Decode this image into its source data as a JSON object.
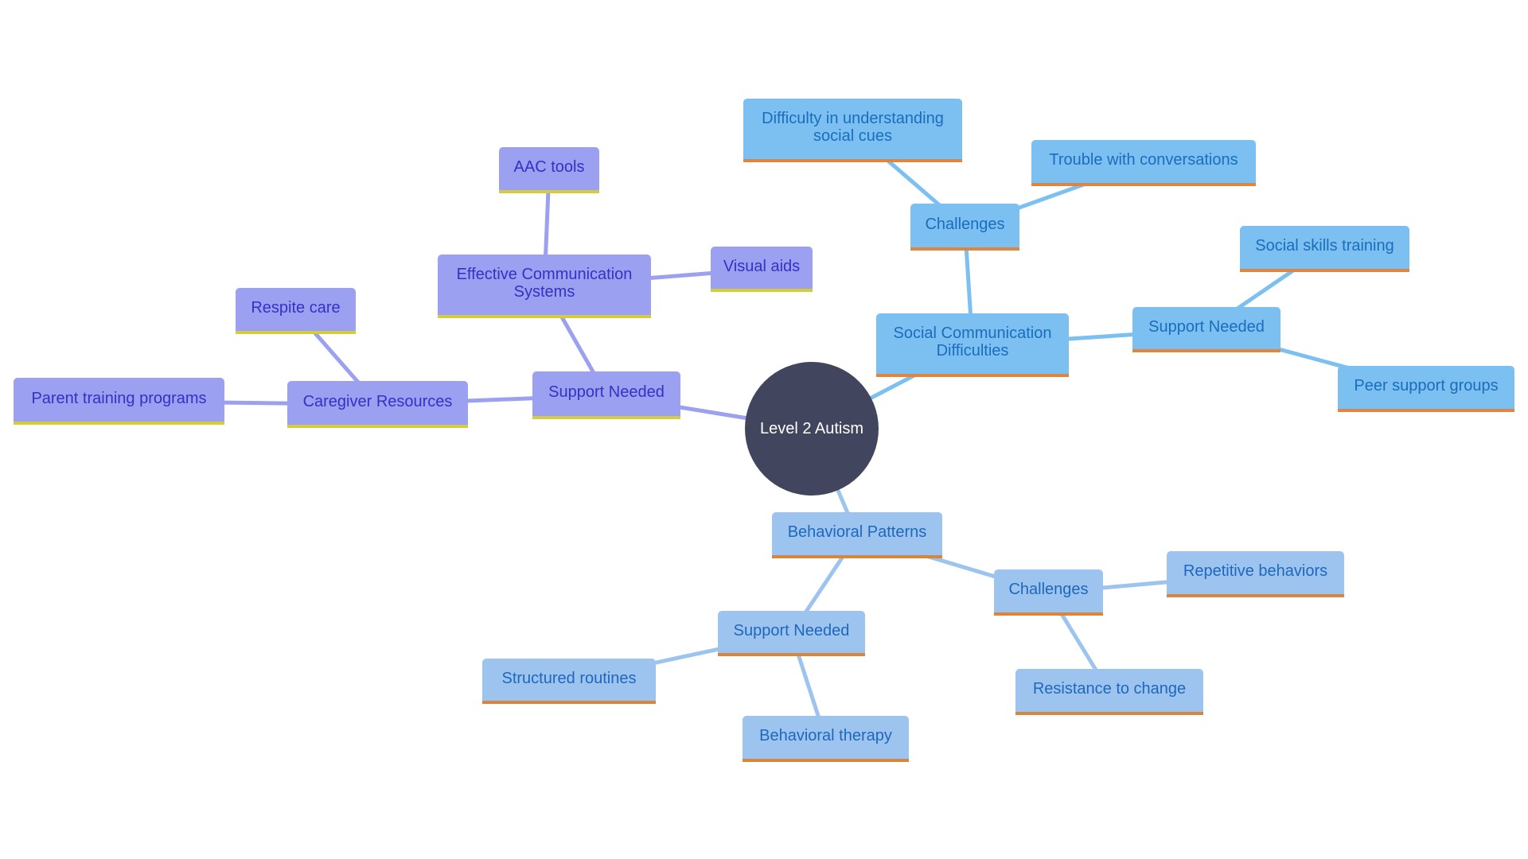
{
  "diagram": {
    "type": "mindmap",
    "colors": {
      "root_fill": "#41455d",
      "root_text": "#ffffff",
      "purple_fill": "#9ba0f1",
      "purple_text": "#3432c4",
      "purple_accent": "#d4cc38",
      "blue_fill": "#7cc0f1",
      "blue_text": "#1a6dbd",
      "blue_accent": "#e0843e",
      "lightblue_fill": "#9dc4ef",
      "lightblue_text": "#1d68bd",
      "lightblue_accent": "#d9853a"
    },
    "root": {
      "id": "root",
      "label": "Level 2 Autism"
    },
    "nodes": [
      {
        "id": "p_support",
        "label": "Support Needed",
        "parent": "root",
        "branch": "purple"
      },
      {
        "id": "p_ecs",
        "label": "Effective Communication Systems",
        "parent": "p_support",
        "branch": "purple"
      },
      {
        "id": "p_aac",
        "label": "AAC tools",
        "parent": "p_ecs",
        "branch": "purple"
      },
      {
        "id": "p_visual",
        "label": "Visual aids",
        "parent": "p_ecs",
        "branch": "purple"
      },
      {
        "id": "p_caregiver",
        "label": "Caregiver Resources",
        "parent": "p_support",
        "branch": "purple"
      },
      {
        "id": "p_respite",
        "label": "Respite care",
        "parent": "p_caregiver",
        "branch": "purple"
      },
      {
        "id": "p_parent",
        "label": "Parent training programs",
        "parent": "p_caregiver",
        "branch": "purple"
      },
      {
        "id": "b_scd",
        "label": "Social Communication Difficulties",
        "parent": "root",
        "branch": "blue"
      },
      {
        "id": "b_challenges",
        "label": "Challenges",
        "parent": "b_scd",
        "branch": "blue"
      },
      {
        "id": "b_cues",
        "label": "Difficulty in understanding social cues",
        "parent": "b_challenges",
        "branch": "blue"
      },
      {
        "id": "b_conv",
        "label": "Trouble with conversations",
        "parent": "b_challenges",
        "branch": "blue"
      },
      {
        "id": "b_support",
        "label": "Support Needed",
        "parent": "b_scd",
        "branch": "blue"
      },
      {
        "id": "b_skills",
        "label": "Social skills training",
        "parent": "b_support",
        "branch": "blue"
      },
      {
        "id": "b_peer",
        "label": "Peer support groups",
        "parent": "b_support",
        "branch": "blue"
      },
      {
        "id": "l_bp",
        "label": "Behavioral Patterns",
        "parent": "root",
        "branch": "lightblue"
      },
      {
        "id": "l_challenges",
        "label": "Challenges",
        "parent": "l_bp",
        "branch": "lightblue"
      },
      {
        "id": "l_repetitive",
        "label": "Repetitive behaviors",
        "parent": "l_challenges",
        "branch": "lightblue"
      },
      {
        "id": "l_resistance",
        "label": "Resistance to change",
        "parent": "l_challenges",
        "branch": "lightblue"
      },
      {
        "id": "l_support",
        "label": "Support Needed",
        "parent": "l_bp",
        "branch": "lightblue"
      },
      {
        "id": "l_routines",
        "label": "Structured routines",
        "parent": "l_support",
        "branch": "lightblue"
      },
      {
        "id": "l_therapy",
        "label": "Behavioral therapy",
        "parent": "l_support",
        "branch": "lightblue"
      }
    ]
  }
}
